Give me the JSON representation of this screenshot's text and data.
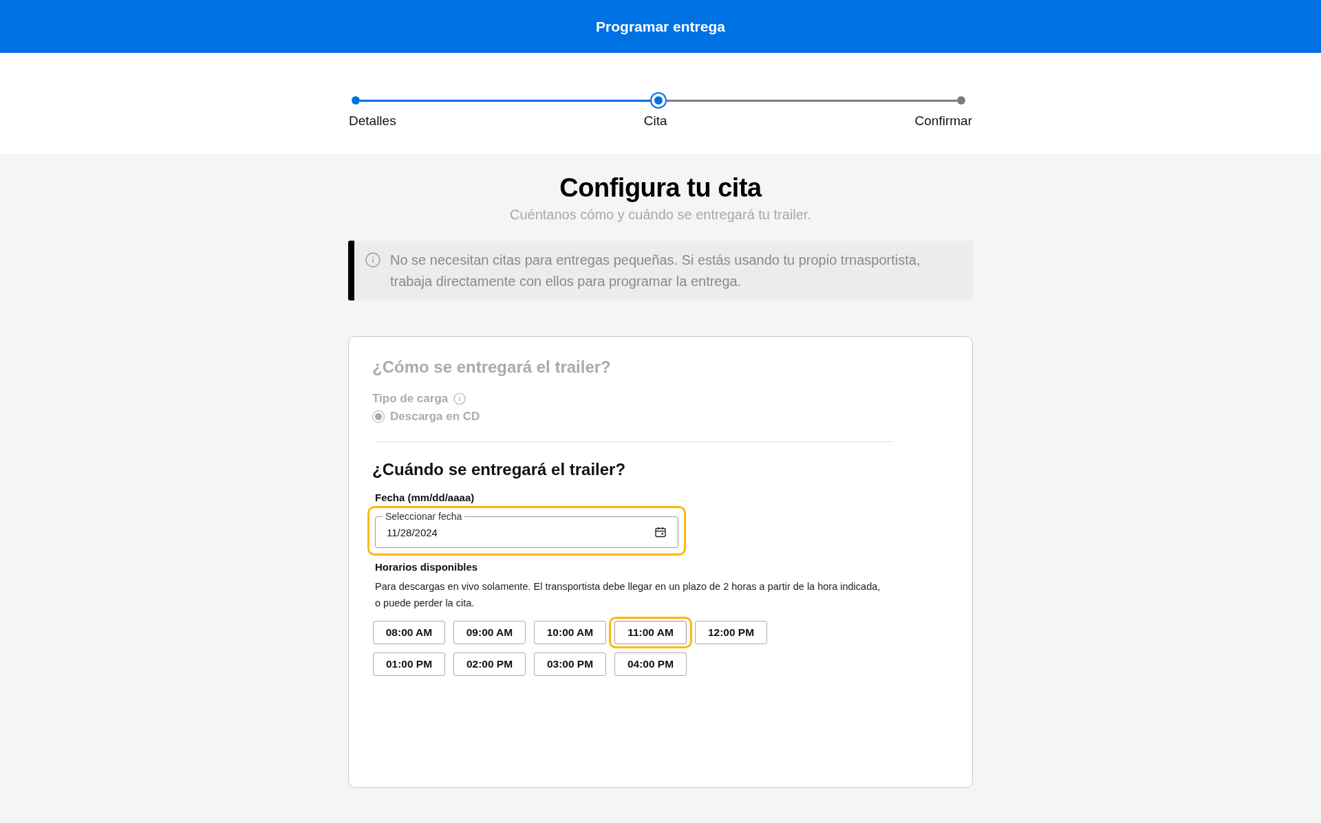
{
  "header": {
    "title": "Programar entrega"
  },
  "steps": [
    {
      "label": "Detalles",
      "completed": true,
      "selected": false
    },
    {
      "label": "Cita",
      "completed": false,
      "selected": true
    },
    {
      "label": "Confirmar",
      "completed": false,
      "selected": false
    }
  ],
  "page": {
    "title": "Configura tu cita",
    "subtitle": "Cuéntanos cómo y cuándo se entregará tu trailer."
  },
  "notice": {
    "text": "No se necesitan citas para entregas pequeñas. Si estás usando tu propio trnasportista, trabaja directamente con ellos para programar la entrega."
  },
  "how": {
    "heading": "¿Cómo se entregará el trailer?",
    "field_label": "Tipo de carga",
    "disabled": true,
    "options": [
      {
        "label": "Descarga en CD",
        "selected": true
      }
    ]
  },
  "when": {
    "heading": "¿Cuándo se entregará el trailer?",
    "date_label": "Fecha (mm/dd/aaaa)",
    "date_field": {
      "label": "Seleccionar fecha",
      "value": "11/28/2024",
      "highlighted": true
    },
    "slots_label": "Horarios disponibles",
    "slots_hint": "Para descargas en vivo solamente. El transportista debe llegar en un plazo de 2 horas a partir de la hora indicada, o puede perder la cita.",
    "slots": [
      {
        "label": "08:00 AM",
        "highlighted": false
      },
      {
        "label": "09:00 AM",
        "highlighted": false
      },
      {
        "label": "10:00 AM",
        "highlighted": false
      },
      {
        "label": "11:00 AM",
        "highlighted": true
      },
      {
        "label": "12:00 PM",
        "highlighted": false
      },
      {
        "label": "01:00 PM",
        "highlighted": false
      },
      {
        "label": "02:00 PM",
        "highlighted": false
      },
      {
        "label": "03:00 PM",
        "highlighted": false
      },
      {
        "label": "04:00 PM",
        "highlighted": false
      }
    ]
  }
}
